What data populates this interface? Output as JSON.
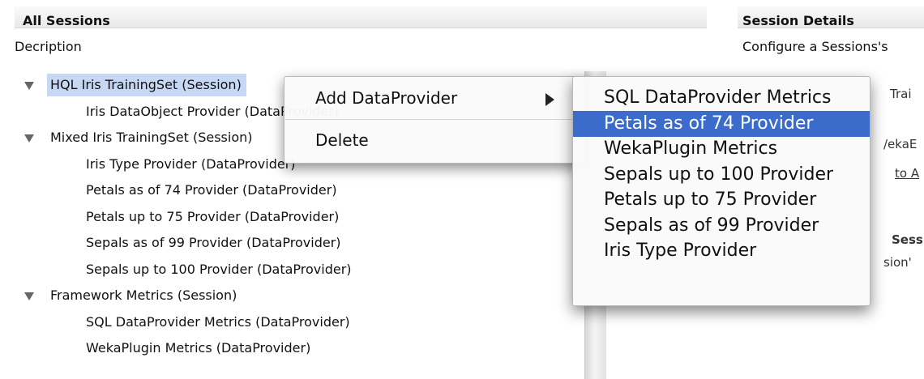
{
  "left_panel": {
    "title": "All Sessions",
    "description": "Decription"
  },
  "right_panel": {
    "title": "Session Details",
    "description": "Configure a Sessions's",
    "ghost_text": {
      "trai": "Trai",
      "weka": "/ekaE",
      "to_a": "to A",
      "sess": "Sess",
      "sion": "sion'"
    }
  },
  "tree": {
    "items": [
      {
        "label": "HQL Iris TrainingSet (Session)",
        "type": "session",
        "expanded": true,
        "selected": true
      },
      {
        "label": "Iris DataObject Provider (DataProvider)",
        "type": "provider"
      },
      {
        "label": "Mixed Iris TrainingSet (Session)",
        "type": "session",
        "expanded": true
      },
      {
        "label": "Iris Type Provider (DataProvider)",
        "type": "provider"
      },
      {
        "label": "Petals as of 74 Provider (DataProvider)",
        "type": "provider"
      },
      {
        "label": "Petals up to 75 Provider (DataProvider)",
        "type": "provider"
      },
      {
        "label": "Sepals as of 99 Provider (DataProvider)",
        "type": "provider"
      },
      {
        "label": "Sepals up to 100 Provider (DataProvider)",
        "type": "provider"
      },
      {
        "label": "Framework Metrics (Session)",
        "type": "session",
        "expanded": true
      },
      {
        "label": "SQL DataProvider Metrics (DataProvider)",
        "type": "provider"
      },
      {
        "label": "WekaPlugin Metrics (DataProvider)",
        "type": "provider"
      }
    ]
  },
  "context_menu": {
    "add_label": "Add DataProvider",
    "delete_label": "Delete"
  },
  "submenu": {
    "items": [
      {
        "label": "SQL DataProvider Metrics"
      },
      {
        "label": "Petals as of 74 Provider",
        "active": true
      },
      {
        "label": "WekaPlugin Metrics"
      },
      {
        "label": "Sepals up to 100 Provider"
      },
      {
        "label": "Petals up to 75 Provider"
      },
      {
        "label": "Sepals as of 99 Provider"
      },
      {
        "label": "Iris Type Provider"
      }
    ]
  },
  "colors": {
    "selection": "#c7d8f5",
    "menu_highlight": "#3b6ccc"
  }
}
